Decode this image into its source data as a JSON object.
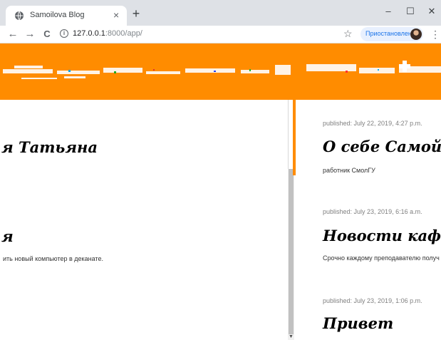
{
  "browser": {
    "tab_title": "Samoilova Blog",
    "tab_close": "×",
    "new_tab": "+",
    "window_controls": {
      "minimize": "–",
      "maximize": "☐",
      "close": "✕"
    },
    "nav": {
      "back": "←",
      "forward": "→",
      "reload": "C"
    },
    "url_host": "127.0.0.1",
    "url_rest": ":8000/app/",
    "bookmark_star": "☆",
    "profile_label": "Приостановлена",
    "menu": "⋮",
    "icons": [
      "globe-icon",
      "info-icon",
      "star-icon",
      "avatar",
      "kebab-menu-icon"
    ]
  },
  "left_column": {
    "posts": [
      {
        "title": "я Татьяна"
      },
      {
        "title": "я",
        "text": "ить новый компьютер в деканате."
      }
    ]
  },
  "right_column": {
    "posts": [
      {
        "published": "published: July 22, 2019, 4:27 p.m.",
        "title": "О себе Самойлова",
        "text": "работник СмолГУ"
      },
      {
        "published": "published: July 23, 2019, 6:16 a.m.",
        "title": "Новости кафедр",
        "text": "Срочно каждому преподавателю получ"
      },
      {
        "published": "published: July 23, 2019, 1:06 p.m.",
        "title": "Привет"
      }
    ]
  },
  "colors": {
    "accent": "#ff8c00",
    "tabbar": "#dee1e6",
    "chip": "#e8f0fe",
    "chip_text": "#1a73e8"
  }
}
